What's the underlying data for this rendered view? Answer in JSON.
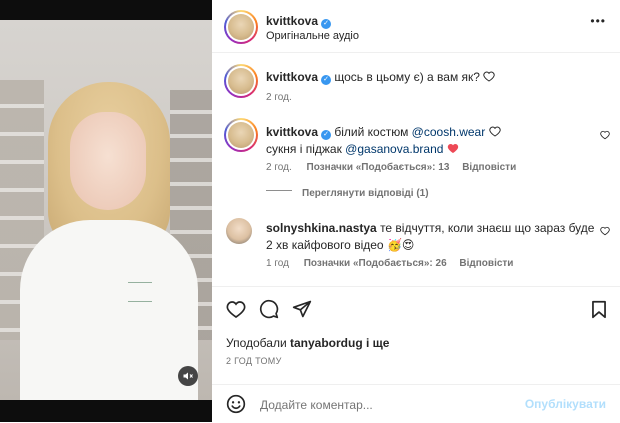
{
  "header": {
    "username": "kvittkova",
    "subtitle": "Оригінальне аудіо",
    "more": "•••"
  },
  "caption": {
    "username": "kvittkova",
    "text": "щось в цьому є) а вам як?",
    "time": "2 год."
  },
  "comments": [
    {
      "username": "kvittkova",
      "text_before": "білий костюм ",
      "mention1": "@coosh.wear",
      "line2_before": "сукня і піджак ",
      "mention2": "@gasanova.brand",
      "time": "2 год.",
      "likes": "Позначки «Подобається»: 13",
      "reply": "Відповісти",
      "view_replies": "Переглянути відповіді (1)"
    },
    {
      "username": "solnyshkina.nastya",
      "text": "те відчуття, коли знаєш що зараз буде 2 хв кайфового відео",
      "emojis": "🥳😍",
      "time": "1 год",
      "likes": "Позначки «Подобається»: 26",
      "reply": "Відповісти"
    }
  ],
  "likes_line": {
    "prefix": "Уподобали ",
    "user": "tanyabordug",
    "suffix": " і ще"
  },
  "post_time": "2 ГОД ТОМУ",
  "footer": {
    "placeholder": "Додайте коментар...",
    "publish": "Опублікувати"
  },
  "colors": {
    "verified": "#3897f0",
    "mention": "#00376b",
    "muted": "#737373",
    "publish": "#b2dffc",
    "like_red": "#ed4956"
  },
  "icons": [
    "verified-icon",
    "more-icon",
    "heart-icon",
    "comment-icon",
    "share-icon",
    "bookmark-icon",
    "emoji-icon",
    "mute-icon"
  ]
}
